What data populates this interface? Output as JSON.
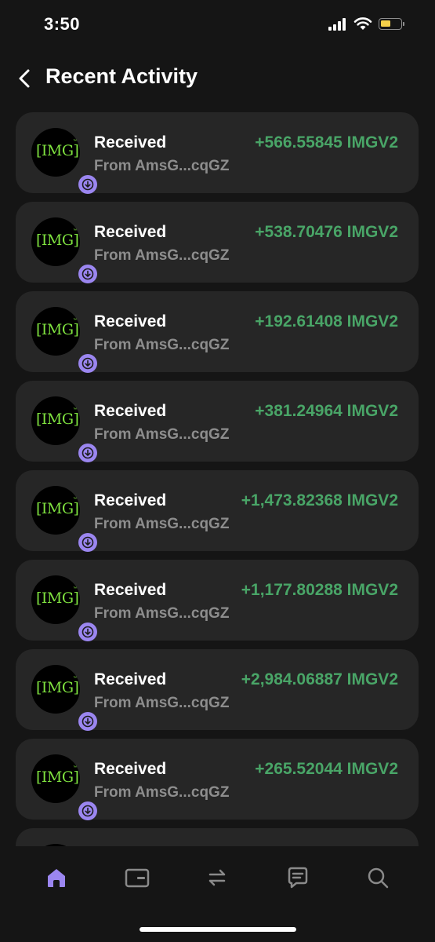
{
  "status_bar": {
    "time": "3:50"
  },
  "header": {
    "title": "Recent Activity"
  },
  "transactions": [
    {
      "title": "Received",
      "subtitle": "From AmsG...cqGZ",
      "amount": "+566.55845 IMGV2",
      "avatar_text": "[IMG]"
    },
    {
      "title": "Received",
      "subtitle": "From AmsG...cqGZ",
      "amount": "+538.70476 IMGV2",
      "avatar_text": "[IMG]"
    },
    {
      "title": "Received",
      "subtitle": "From AmsG...cqGZ",
      "amount": "+192.61408 IMGV2",
      "avatar_text": "[IMG]"
    },
    {
      "title": "Received",
      "subtitle": "From AmsG...cqGZ",
      "amount": "+381.24964 IMGV2",
      "avatar_text": "[IMG]"
    },
    {
      "title": "Received",
      "subtitle": "From AmsG...cqGZ",
      "amount": "+1,473.82368 IMGV2",
      "avatar_text": "[IMG]"
    },
    {
      "title": "Received",
      "subtitle": "From AmsG...cqGZ",
      "amount": "+1,177.80288 IMGV2",
      "avatar_text": "[IMG]"
    },
    {
      "title": "Received",
      "subtitle": "From AmsG...cqGZ",
      "amount": "+2,984.06887 IMGV2",
      "avatar_text": "[IMG]"
    },
    {
      "title": "Received",
      "subtitle": "From AmsG...cqGZ",
      "amount": "+265.52044 IMGV2",
      "avatar_text": "[IMG]"
    }
  ],
  "tab_bar": {
    "tabs": [
      {
        "icon": "home-icon",
        "active": true
      },
      {
        "icon": "wallet-icon",
        "active": false
      },
      {
        "icon": "swap-icon",
        "active": false
      },
      {
        "icon": "chat-icon",
        "active": false
      },
      {
        "icon": "search-icon",
        "active": false
      }
    ],
    "active_color": "#9b86f0",
    "inactive_color": "#8a8a8a"
  },
  "colors": {
    "background": "#151515",
    "card": "#262626",
    "amount_positive": "#49a567",
    "accent": "#9b86f0",
    "avatar_text": "#7fe23f"
  }
}
